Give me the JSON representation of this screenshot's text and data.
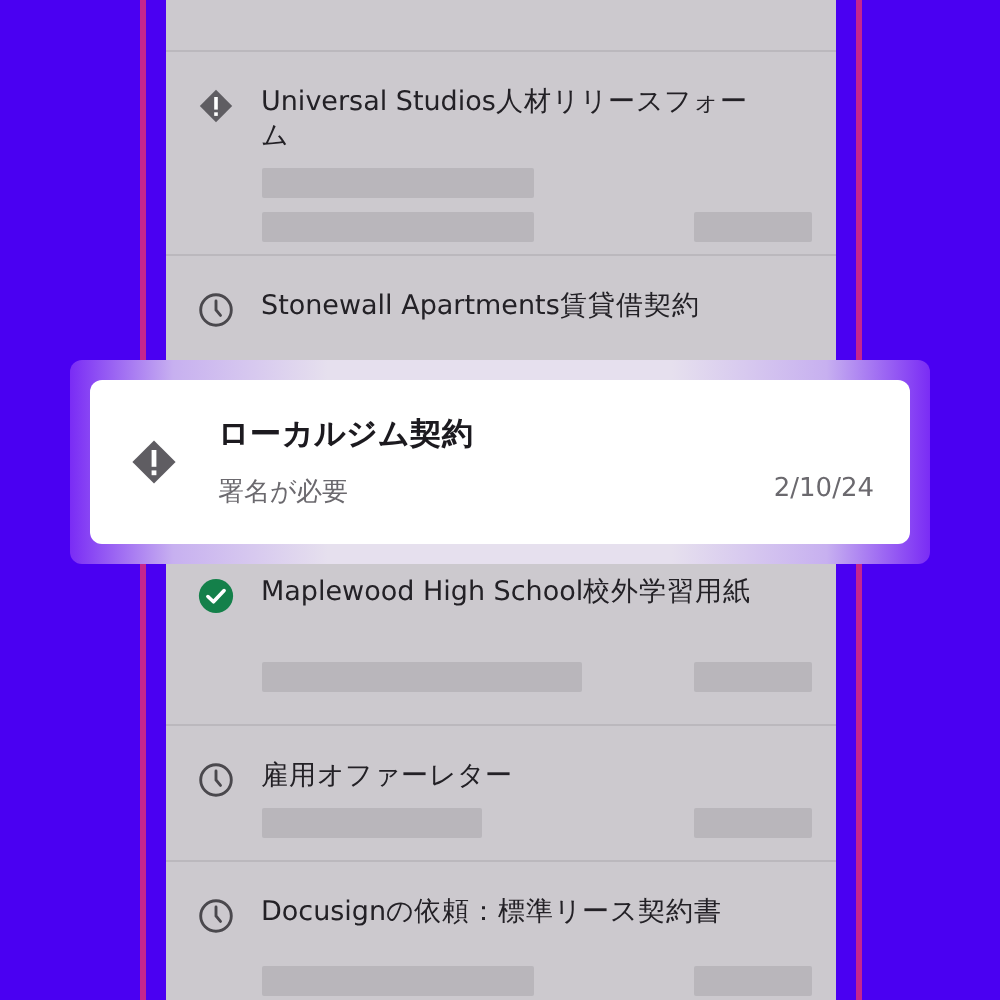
{
  "documents": [
    {
      "title": "Universal Studios人材リリースフォーム",
      "kind": "warning"
    },
    {
      "title": "Stonewall Apartments賃貸借契約",
      "kind": "pending"
    },
    {
      "title": "Maplewood High School校外学習用紙",
      "kind": "completed"
    },
    {
      "title": "雇用オファーレター",
      "kind": "pending"
    },
    {
      "title": "Docusignの依頼：標準リース契約書",
      "kind": "pending"
    }
  ],
  "highlight": {
    "title": "ローカルジム契約",
    "kind": "warning",
    "status": "署名が必要",
    "date": "2/10/24"
  }
}
